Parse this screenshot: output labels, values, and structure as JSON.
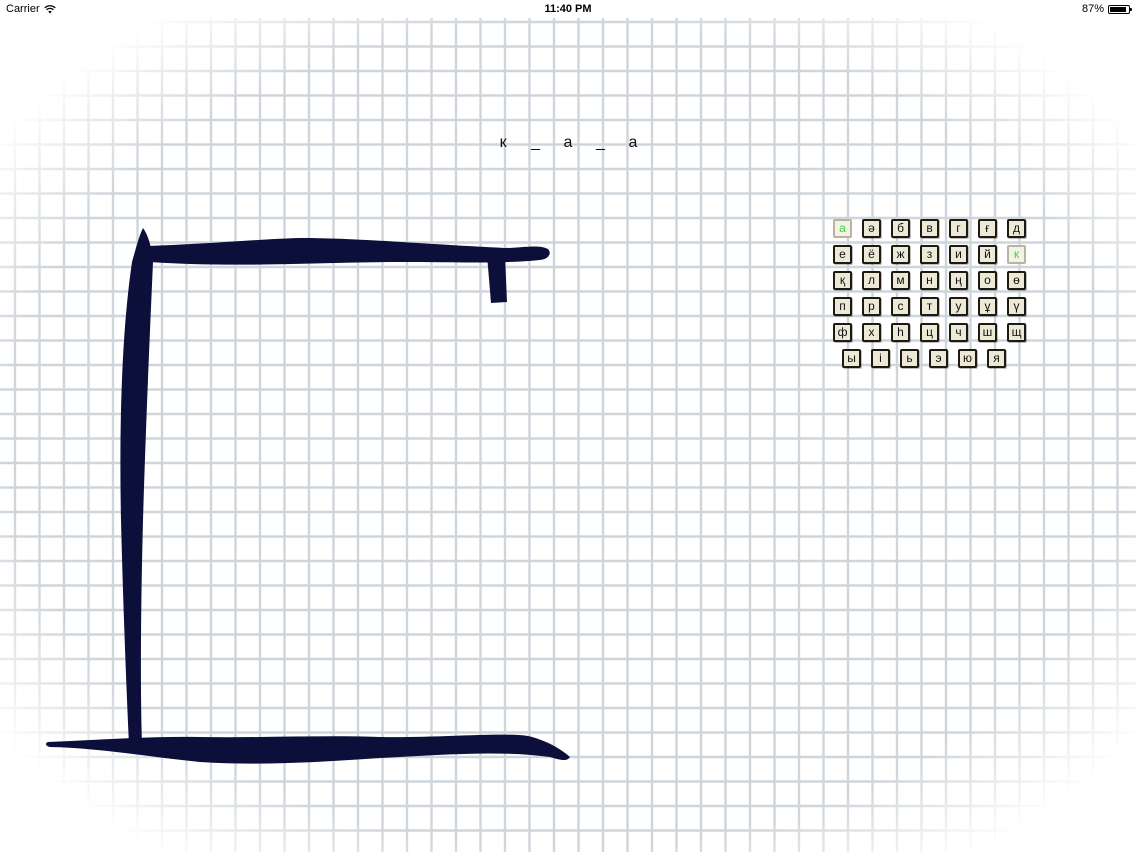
{
  "status_bar": {
    "carrier": "Carrier",
    "time": "11:40 PM",
    "battery": "87%",
    "battery_level": 0.87
  },
  "word": {
    "slots": [
      "к",
      "_",
      "а",
      "_",
      "а"
    ]
  },
  "keyboard": {
    "rows": [
      [
        {
          "letter": "а",
          "used": true
        },
        {
          "letter": "ә",
          "used": false
        },
        {
          "letter": "б",
          "used": false
        },
        {
          "letter": "в",
          "used": false
        },
        {
          "letter": "г",
          "used": false
        },
        {
          "letter": "ғ",
          "used": false
        },
        {
          "letter": "д",
          "used": false
        }
      ],
      [
        {
          "letter": "е",
          "used": false
        },
        {
          "letter": "ё",
          "used": false
        },
        {
          "letter": "ж",
          "used": false
        },
        {
          "letter": "з",
          "used": false
        },
        {
          "letter": "и",
          "used": false
        },
        {
          "letter": "й",
          "used": false
        },
        {
          "letter": "к",
          "used": true
        }
      ],
      [
        {
          "letter": "қ",
          "used": false
        },
        {
          "letter": "л",
          "used": false
        },
        {
          "letter": "м",
          "used": false
        },
        {
          "letter": "н",
          "used": false
        },
        {
          "letter": "ң",
          "used": false
        },
        {
          "letter": "о",
          "used": false
        },
        {
          "letter": "ө",
          "used": false
        }
      ],
      [
        {
          "letter": "п",
          "used": false
        },
        {
          "letter": "р",
          "used": false
        },
        {
          "letter": "с",
          "used": false
        },
        {
          "letter": "т",
          "used": false
        },
        {
          "letter": "у",
          "used": false
        },
        {
          "letter": "ұ",
          "used": false
        },
        {
          "letter": "ү",
          "used": false
        }
      ],
      [
        {
          "letter": "ф",
          "used": false
        },
        {
          "letter": "х",
          "used": false
        },
        {
          "letter": "һ",
          "used": false
        },
        {
          "letter": "ц",
          "used": false
        },
        {
          "letter": "ч",
          "used": false
        },
        {
          "letter": "ш",
          "used": false
        },
        {
          "letter": "щ",
          "used": false
        }
      ],
      [
        {
          "letter": "ы",
          "used": false
        },
        {
          "letter": "і",
          "used": false
        },
        {
          "letter": "ь",
          "used": false
        },
        {
          "letter": "э",
          "used": false
        },
        {
          "letter": "ю",
          "used": false
        },
        {
          "letter": "я",
          "used": false
        }
      ]
    ]
  },
  "colors": {
    "gallows": "#0c0f3a",
    "key_used": "#37d93b",
    "grid_line": "#cfd6db"
  }
}
